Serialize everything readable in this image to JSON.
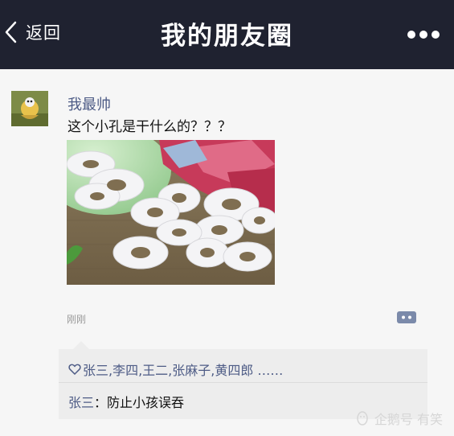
{
  "header": {
    "back_label": "返回",
    "title": "我的朋友圈",
    "more_icon": "more-dots-icon",
    "back_icon": "chevron-left-icon"
  },
  "post": {
    "username": "我最帅",
    "text": "这个小孔是干什么的？？？",
    "timestamp": "刚刚",
    "comment_icon": "comment-bubble-icon"
  },
  "likes": {
    "icon": "heart-outline-icon",
    "names": "张三,李四,王二,张麻子,黄四郎 ……"
  },
  "comments": [
    {
      "author": "张三",
      "separator": "：",
      "text": "防止小孩误吞"
    }
  ],
  "watermark": {
    "text": "企鹅号 有笑"
  },
  "colors": {
    "header_bg": "#1f2230",
    "page_bg": "#f6f6f6",
    "name_blue": "#4e5c86",
    "social_bg": "#ededed"
  }
}
